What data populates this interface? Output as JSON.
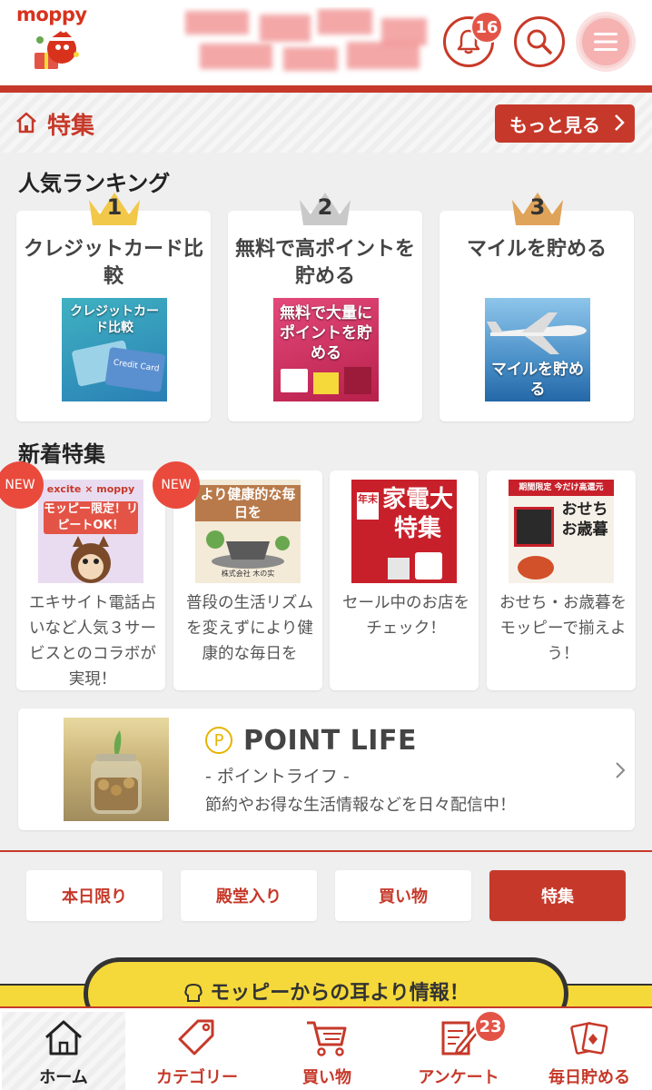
{
  "header": {
    "logo_text": "moppy",
    "notification_count": "16"
  },
  "feature": {
    "title": "特集",
    "more_label": "もっと見る"
  },
  "ranking": {
    "label": "人気ランキング",
    "items": [
      {
        "rank": "1",
        "title": "クレジットカード比較",
        "thumb_caption": "クレジットカード比較",
        "thumb_sub": "Credit Card"
      },
      {
        "rank": "2",
        "title": "無料で高ポイントを貯める",
        "thumb_caption": "無料で大量にポイントを貯める"
      },
      {
        "rank": "3",
        "title": "マイルを貯める",
        "thumb_caption": "マイルを貯める"
      }
    ]
  },
  "new_features": {
    "label": "新着特集",
    "new_badge": "NEW",
    "items": [
      {
        "desc": "エキサイト電話占いなど人気３サービスとのコラボが実現！",
        "thumb_top": "excite × moppy",
        "thumb_caption": "モッピー限定！リピートOK！"
      },
      {
        "desc": "普段の生活リズムを変えずにより健康的な毎日を",
        "thumb_caption": "より健康的な毎日を",
        "thumb_sub": "株式会社 木の实"
      },
      {
        "desc": "セール中のお店をチェック！",
        "thumb_tag": "年末",
        "thumb_caption": "家電大特集"
      },
      {
        "desc": "おせち・お歳暮をモッピーで揃えよう！",
        "thumb_top": "期間限定 今だけ高還元",
        "thumb_caption": "おせち お歳暮"
      }
    ]
  },
  "point_life": {
    "title": "POINT LIFE",
    "subtitle": "- ポイントライフ -",
    "text": "節約やお得な生活情報などを日々配信中！",
    "p_mark": "P"
  },
  "tabs": [
    {
      "label": "本日限り",
      "active": false
    },
    {
      "label": "殿堂入り",
      "active": false
    },
    {
      "label": "買い物",
      "active": false
    },
    {
      "label": "特集",
      "active": true
    }
  ],
  "info_banner": "モッピーからの耳より情報！",
  "bottom_nav": {
    "items": [
      {
        "label": "ホーム"
      },
      {
        "label": "カテゴリー"
      },
      {
        "label": "買い物"
      },
      {
        "label": "アンケート"
      },
      {
        "label": "毎日貯める"
      }
    ],
    "survey_badge": "23"
  },
  "colors": {
    "brand_red": "#c6392a",
    "badge_red": "#e35447",
    "yellow": "#f5d93a"
  }
}
